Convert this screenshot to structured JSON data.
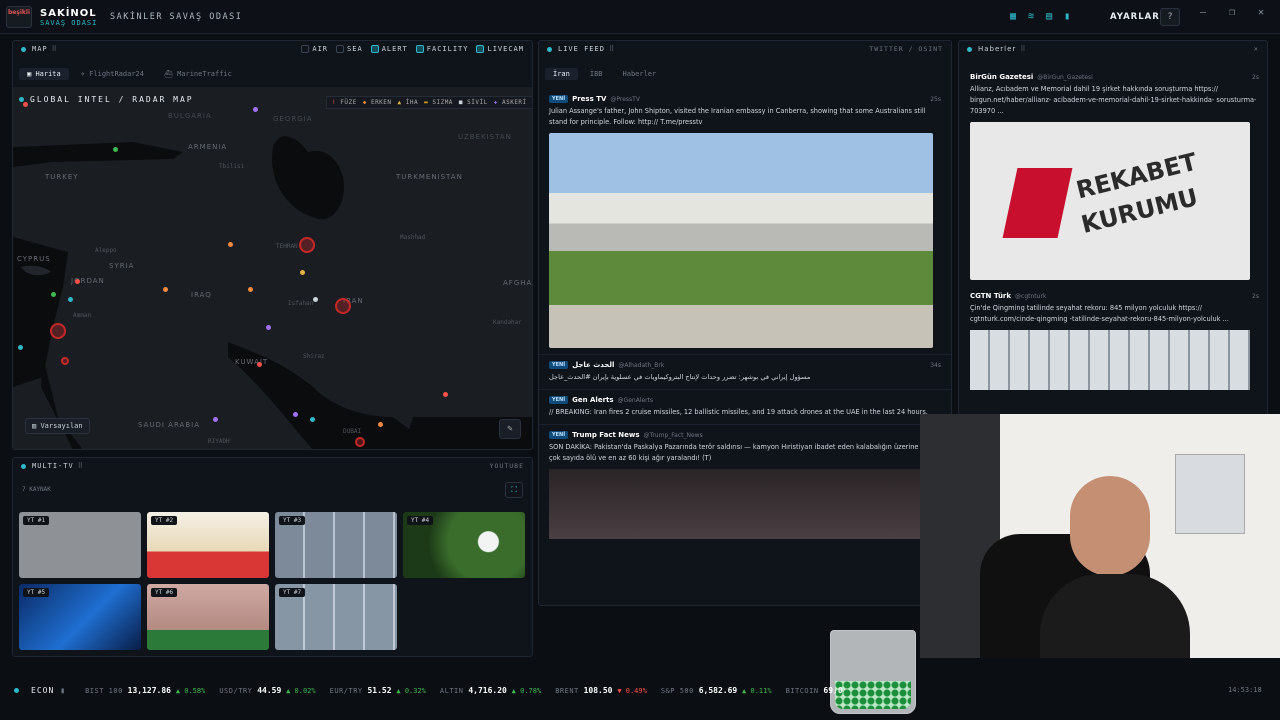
{
  "header": {
    "logo_text": "beşikli",
    "brand": "SAKİNOL",
    "brand_sub": "SAVAŞ ODASI",
    "room_title": "SAKİNLER SAVAŞ ODASI",
    "settings_label": "AYARLAR",
    "help_label": "?"
  },
  "map_panel": {
    "title": "MAP",
    "filters": [
      {
        "label": "AIR",
        "checked": false
      },
      {
        "label": "SEA",
        "checked": false
      },
      {
        "label": "ALERT",
        "checked": true
      },
      {
        "label": "FACILITY",
        "checked": true
      },
      {
        "label": "LIVECAM",
        "checked": true
      }
    ],
    "tabs": [
      "Harita",
      "FlightRadar24",
      "MarineTraffic"
    ],
    "map_title": "GLOBAL INTEL / RADAR MAP",
    "legend": [
      "FÜZE",
      "ERKEN",
      "İHA",
      "SIZMA",
      "SİVİL",
      "ASKERİ"
    ],
    "layer_button": "Varsayılan",
    "country_labels": [
      "BULGARIA",
      "GEORGIA",
      "UZBEKISTAN",
      "ARMENIA",
      "TURKEY",
      "TURKMENISTAN",
      "CYPRUS",
      "SYRIA",
      "IRAQ",
      "IRAN",
      "AFGHA",
      "SAUDI ARABIA",
      "JORDAN",
      "KUWAIT"
    ],
    "city_labels": [
      "Tbilisi",
      "Aleppo",
      "Mashhad",
      "TEHRAN",
      "Isfahan",
      "Kandahar",
      "Shiraz",
      "RIYADH",
      "DUBAI",
      "Amman"
    ]
  },
  "multitv": {
    "title": "MULTI-TV",
    "source": "YOUTUBE",
    "count_label": "7 KAYNAK",
    "tiles": [
      "YT #1",
      "YT #2",
      "YT #3",
      "YT #4",
      "YT #5",
      "YT #6",
      "YT #7"
    ]
  },
  "live_feed": {
    "title": "LIVE FEED",
    "source": "TWITTER / OSINT",
    "tabs": [
      "İran",
      "İBB",
      "Haberler"
    ],
    "items": [
      {
        "badge": "YENİ",
        "name": "Press TV",
        "handle": "@PressTV",
        "time": "25s",
        "text": "Julian Assange's father, John Shipton, visited the Iranian embassy in Canberra, showing that some Australians still stand for principle. Follow: http:// T.me/presstv"
      },
      {
        "badge": "YENİ",
        "name": "الحدث عاجل",
        "handle": "@Alhadath_Brk",
        "time": "34s",
        "text": "مسؤول إيراني في بوشهر: تضرر وحدات لإنتاج البتروكيماويات في عسلوية بإيران #الحدث_عاجل"
      },
      {
        "badge": "YENİ",
        "name": "Gen Alerts",
        "handle": "@GenAlerts",
        "time": "",
        "text": "// BREAKING: Iran fires 2 cruise missiles, 12 ballistic missiles, and 19 attack drones at the UAE in the last 24 hours."
      },
      {
        "badge": "YENİ",
        "name": "Trump Fact News",
        "handle": "@Trump_Fact_News",
        "time": "",
        "text": "SON DAKİKA: Pakistan'da Paskalya Pazarında terör saldırısı — kamyon Hıristiyan ibadet eden kalabalığın üzerine daldı, çok sayıda ölü ve en az 60 kişi ağır yaralandı! (T)"
      }
    ]
  },
  "news": {
    "title": "Haberler",
    "items": [
      {
        "name": "BirGün Gazetesi",
        "handle": "@BirGun_Gazetesi",
        "time": "2s",
        "text": "Allianz, Acıbadem ve Memorial dahil 19 şirket hakkında soruşturma https:// birgun.net/haber/allianz- acibadem-ve-memorial-dahil-19-sirket-hakkinda- sorusturma-703970 ...",
        "image_text_1": "REKABET",
        "image_text_2": "KURUMU"
      },
      {
        "name": "CGTN Türk",
        "handle": "@cgtnturk",
        "time": "2s",
        "text": "Çin'de Qingming tatilinde seyahat rekoru: 845 milyon yolculuk https:// cgtnturk.com/cinde-qingming -tatilinde-seyahat-rekoru-845-milyon-yolculuk ..."
      }
    ]
  },
  "econ": {
    "title": "ECON",
    "tickers": [
      {
        "name": "BIST 100",
        "value": "13,127.86",
        "change": "▲ 0.58%",
        "dir": "up"
      },
      {
        "name": "USD/TRY",
        "value": "44.59",
        "change": "▲ 0.02%",
        "dir": "up"
      },
      {
        "name": "EUR/TRY",
        "value": "51.52",
        "change": "▲ 0.32%",
        "dir": "up"
      },
      {
        "name": "ALTIN",
        "value": "4,716.20",
        "change": "▲ 0.78%",
        "dir": "up"
      },
      {
        "name": "BRENT",
        "value": "108.50",
        "change": "▼ 0.49%",
        "dir": "dn"
      },
      {
        "name": "S&P 500",
        "value": "6,582.69",
        "change": "▲ 0.11%",
        "dir": "up"
      },
      {
        "name": "BITCOIN",
        "value": "69,0",
        "change": "",
        "dir": "up"
      }
    ],
    "clock": "14:53:18"
  },
  "colors": {
    "accent": "#2fb8c9",
    "alert_red": "#c62828",
    "up": "#3fb950",
    "down": "#f85149"
  }
}
